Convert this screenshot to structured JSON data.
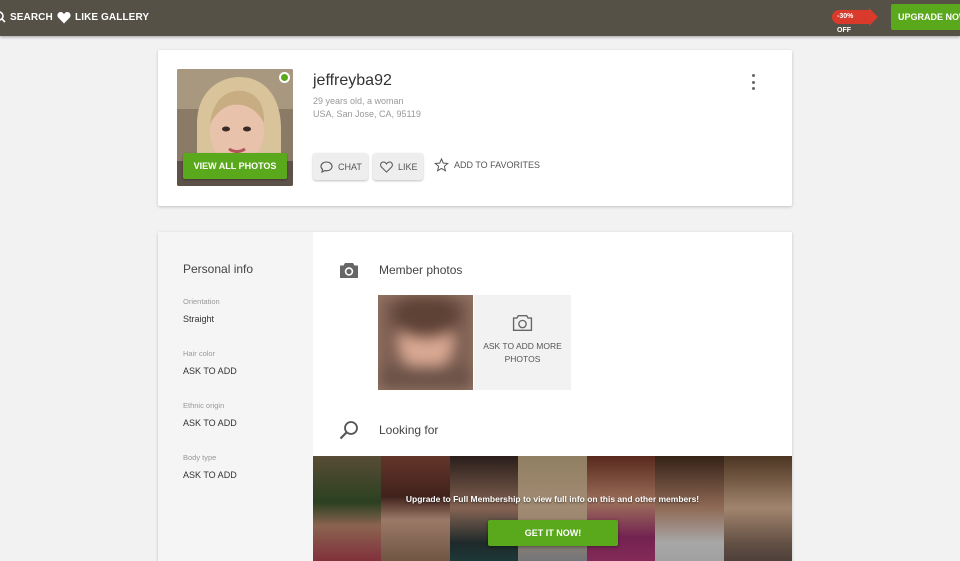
{
  "colors": {
    "topbar": "#555147",
    "accent_green": "#5aa81c",
    "discount_red": "#d93a2b"
  },
  "nav": {
    "search_label": "SEARCH",
    "search_icon": "search-icon",
    "like_gallery_label": "LIKE GALLERY",
    "like_gallery_icon": "heart-icon",
    "discount_label": "-30% OFF",
    "upgrade_label": "UPGRADE NOW"
  },
  "profile": {
    "username": "jeffreyba92",
    "age_line": "29 years old, a woman",
    "location_line": "USA, San Jose, CA, 95119",
    "online": true,
    "view_photos_label": "VIEW ALL PHOTOS",
    "chat_label": "CHAT",
    "like_label": "LIKE",
    "favorites_label": "ADD TO FAVORITES"
  },
  "personal_info": {
    "title": "Personal info",
    "fields": [
      {
        "label": "Orientation",
        "value": "Straight"
      },
      {
        "label": "Hair color",
        "value": "ASK TO ADD"
      },
      {
        "label": "Ethnic origin",
        "value": "ASK TO ADD"
      },
      {
        "label": "Body type",
        "value": "ASK TO ADD"
      }
    ]
  },
  "member_photos": {
    "title": "Member photos",
    "ask_more_label": "ASK TO ADD MORE PHOTOS"
  },
  "looking_for": {
    "title": "Looking for",
    "upgrade_text": "Upgrade to Full Membership to view full info on this and other members!",
    "cta_label": "GET IT NOW!"
  }
}
